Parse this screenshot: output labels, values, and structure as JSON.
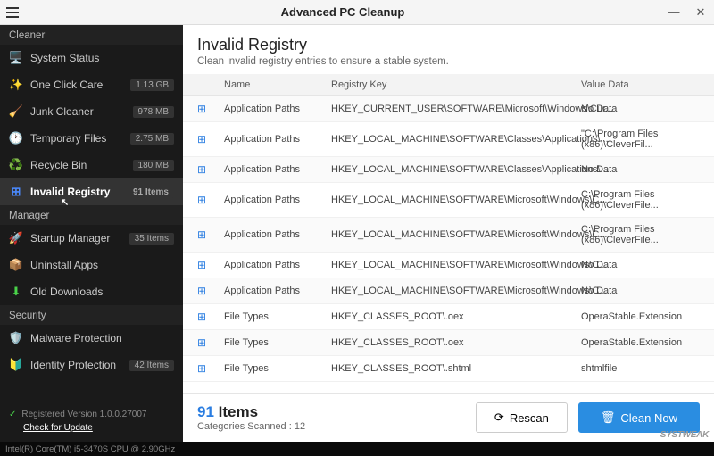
{
  "titlebar": {
    "title": "Advanced PC Cleanup"
  },
  "sidebar": {
    "sections": {
      "cleaner": "Cleaner",
      "manager": "Manager",
      "security": "Security"
    },
    "items": [
      {
        "label": "System Status",
        "badge": ""
      },
      {
        "label": "One Click Care",
        "badge": "1.13 GB"
      },
      {
        "label": "Junk Cleaner",
        "badge": "978 MB"
      },
      {
        "label": "Temporary Files",
        "badge": "2.75 MB"
      },
      {
        "label": "Recycle Bin",
        "badge": "180 MB"
      },
      {
        "label": "Invalid Registry",
        "badge": "91 Items"
      },
      {
        "label": "Startup Manager",
        "badge": "35 Items"
      },
      {
        "label": "Uninstall Apps",
        "badge": ""
      },
      {
        "label": "Old Downloads",
        "badge": ""
      },
      {
        "label": "Malware Protection",
        "badge": ""
      },
      {
        "label": "Identity Protection",
        "badge": "42 Items"
      }
    ],
    "registered": "Registered Version 1.0.0.27007",
    "check_update": "Check for Update"
  },
  "statusbar": {
    "cpu": "Intel(R) Core(TM) i5-3470S CPU @ 2.90GHz"
  },
  "content": {
    "title": "Invalid Registry",
    "subtitle": "Clean invalid registry entries to ensure a stable system.",
    "headers": {
      "name": "Name",
      "key": "Registry Key",
      "value": "Value Data"
    },
    "rows": [
      {
        "name": "Application Paths",
        "key": "HKEY_CURRENT_USER\\SOFTWARE\\Microsoft\\Windows\\Cur...",
        "value": "No Data"
      },
      {
        "name": "Application Paths",
        "key": "HKEY_LOCAL_MACHINE\\SOFTWARE\\Classes\\Applications\\...",
        "value": "\"C:\\Program Files (x86)\\CleverFil..."
      },
      {
        "name": "Application Paths",
        "key": "HKEY_LOCAL_MACHINE\\SOFTWARE\\Classes\\Applications\\...",
        "value": "No Data"
      },
      {
        "name": "Application Paths",
        "key": "HKEY_LOCAL_MACHINE\\SOFTWARE\\Microsoft\\Windows\\C...",
        "value": "C:\\Program Files (x86)\\CleverFile..."
      },
      {
        "name": "Application Paths",
        "key": "HKEY_LOCAL_MACHINE\\SOFTWARE\\Microsoft\\Windows\\C...",
        "value": "C:\\Program Files (x86)\\CleverFile..."
      },
      {
        "name": "Application Paths",
        "key": "HKEY_LOCAL_MACHINE\\SOFTWARE\\Microsoft\\Windows\\C...",
        "value": "No Data"
      },
      {
        "name": "Application Paths",
        "key": "HKEY_LOCAL_MACHINE\\SOFTWARE\\Microsoft\\Windows\\C...",
        "value": "No Data"
      },
      {
        "name": "File Types",
        "key": "HKEY_CLASSES_ROOT\\.oex",
        "value": "OperaStable.Extension"
      },
      {
        "name": "File Types",
        "key": "HKEY_CLASSES_ROOT\\.oex",
        "value": "OperaStable.Extension"
      },
      {
        "name": "File Types",
        "key": "HKEY_CLASSES_ROOT\\.shtml",
        "value": "shtmlfile"
      }
    ],
    "footer": {
      "count_num": "91",
      "count_label": "Items",
      "categories": "Categories Scanned : 12",
      "rescan": "Rescan",
      "clean": "Clean Now"
    }
  },
  "watermark": "SYSTWEAK"
}
